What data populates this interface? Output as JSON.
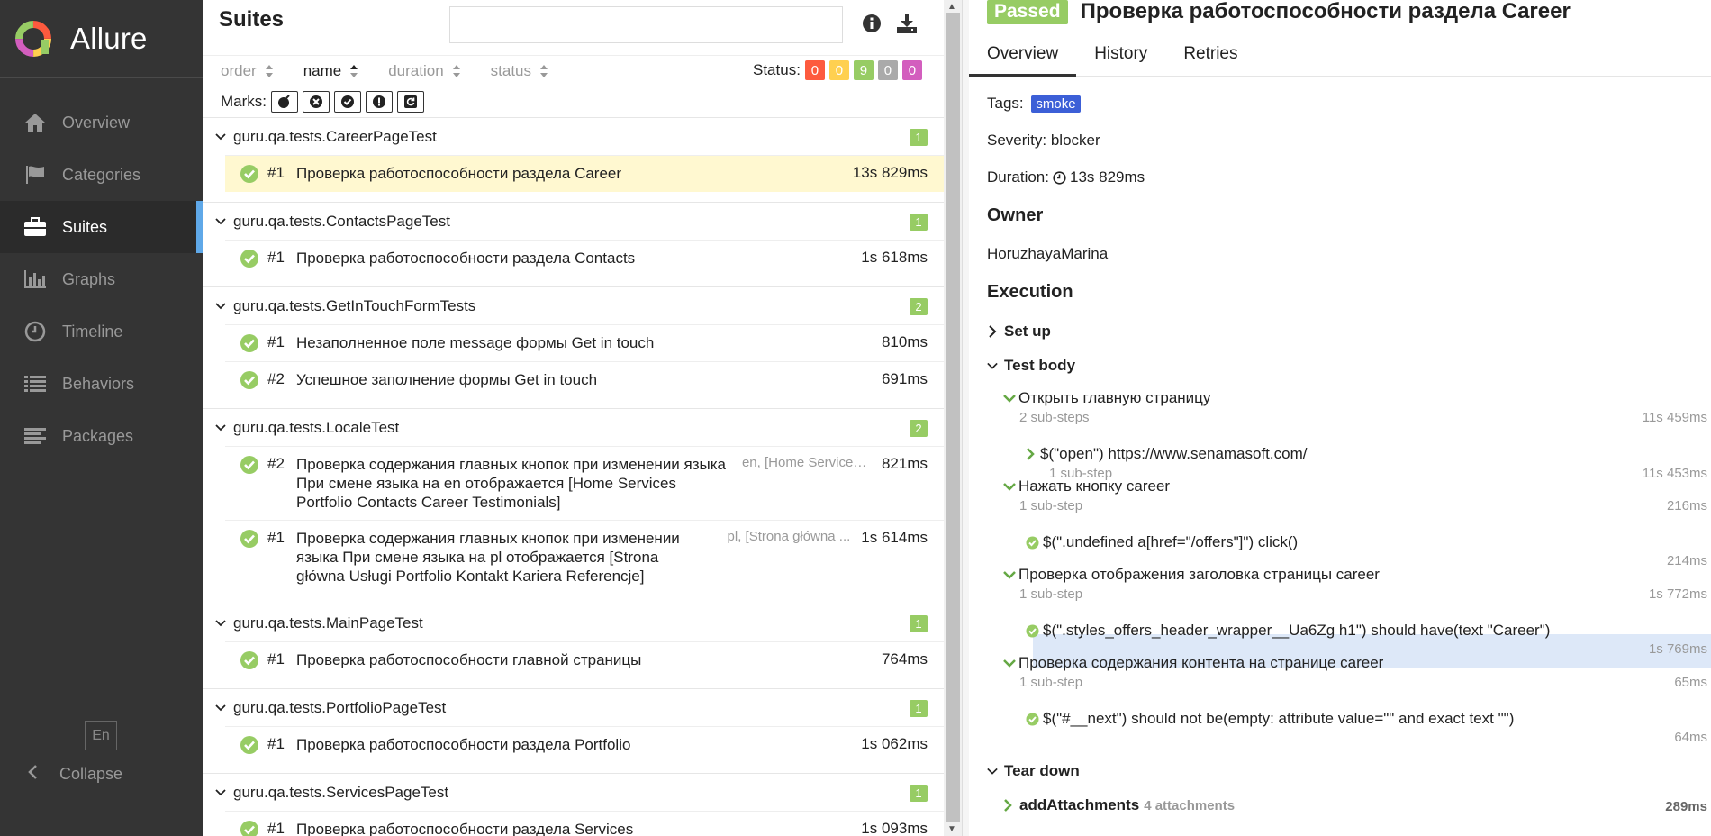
{
  "app": {
    "brand": "Allure",
    "lang": "En",
    "collapse": "Collapse"
  },
  "nav": [
    {
      "label": "Overview",
      "icon": "home-icon"
    },
    {
      "label": "Categories",
      "icon": "flag-icon"
    },
    {
      "label": "Suites",
      "icon": "briefcase-icon"
    },
    {
      "label": "Graphs",
      "icon": "bar-chart-icon"
    },
    {
      "label": "Timeline",
      "icon": "clock-icon"
    },
    {
      "label": "Behaviors",
      "icon": "list-icon"
    },
    {
      "label": "Packages",
      "icon": "align-left-icon"
    }
  ],
  "suites": {
    "title": "Suites",
    "search_placeholder": "",
    "sort": {
      "order": "order",
      "name": "name",
      "duration": "duration",
      "status": "status"
    },
    "status_label": "Status:",
    "status_counts": [
      {
        "value": "0",
        "color": "#fd5a3e"
      },
      {
        "value": "0",
        "color": "#ffd050"
      },
      {
        "value": "9",
        "color": "#97cc64"
      },
      {
        "value": "0",
        "color": "#aaaaaa"
      },
      {
        "value": "0",
        "color": "#d35ebe"
      }
    ],
    "marks_label": "Marks:",
    "groups": [
      {
        "name": "guru.qa.tests.CareerPageTest",
        "count": "1",
        "tests": [
          {
            "num": "#1",
            "name": "Проверка работоспособности раздела Career",
            "params": "",
            "dur": "13s 829ms",
            "selected": true
          }
        ]
      },
      {
        "name": "guru.qa.tests.ContactsPageTest",
        "count": "1",
        "tests": [
          {
            "num": "#1",
            "name": "Проверка работоспособности раздела Contacts",
            "params": "",
            "dur": "1s 618ms"
          }
        ]
      },
      {
        "name": "guru.qa.tests.GetInTouchFormTests",
        "count": "2",
        "tests": [
          {
            "num": "#1",
            "name": "Незаполненное поле message формы Get in touch",
            "params": "",
            "dur": "810ms"
          },
          {
            "num": "#2",
            "name": "Успешное заполнение формы Get in touch",
            "params": "",
            "dur": "691ms"
          }
        ]
      },
      {
        "name": "guru.qa.tests.LocaleTest",
        "count": "2",
        "tests": [
          {
            "num": "#2",
            "name": "Проверка содержания главных кнопок при изменении языка При смене языка на en отображается [Home Services Portfolio Contacts Career Testimonials]",
            "params": "en, [Home Services...",
            "dur": "821ms"
          },
          {
            "num": "#1",
            "name": "Проверка содержания главных кнопок при изменении языка При смене языка на pl отображается [Strona główna Usługi Portfolio Kontakt Kariera Referencje]",
            "params": "pl, [Strona główna ...",
            "dur": "1s 614ms"
          }
        ]
      },
      {
        "name": "guru.qa.tests.MainPageTest",
        "count": "1",
        "tests": [
          {
            "num": "#1",
            "name": "Проверка работоспособности главной страницы",
            "params": "",
            "dur": "764ms"
          }
        ]
      },
      {
        "name": "guru.qa.tests.PortfolioPageTest",
        "count": "1",
        "tests": [
          {
            "num": "#1",
            "name": "Проверка работоспособности раздела Portfolio",
            "params": "",
            "dur": "1s 062ms"
          }
        ]
      },
      {
        "name": "guru.qa.tests.ServicesPageTest",
        "count": "1",
        "tests": [
          {
            "num": "#1",
            "name": "Проверка работоспособности раздела Services",
            "params": "",
            "dur": "1s 093ms"
          }
        ]
      }
    ]
  },
  "detail": {
    "status": "Passed",
    "title": "Проверка работоспособности раздела Career",
    "tabs": [
      "Overview",
      "History",
      "Retries"
    ],
    "tags_label": "Tags:",
    "tag": "smoke",
    "severity": "Severity: blocker",
    "duration_label": "Duration:",
    "duration": "13s 829ms",
    "owner_title": "Owner",
    "owner": "HoruzhayaMarina",
    "execution_title": "Execution",
    "setup": "Set up",
    "test_body": "Test body",
    "teardown": "Tear down",
    "steps": [
      {
        "name": "Открыть главную страницу",
        "sub": "2 sub-steps",
        "time": "11s 459ms"
      },
      {
        "name": "$(\"open\") https://www.senamasoft.com/",
        "sub": "1 sub-step",
        "time": "11s 453ms"
      },
      {
        "name": "Нажать кнопку career",
        "sub": "1 sub-step",
        "time": "216ms"
      },
      {
        "name": "$(\".undefined a[href=\"/offers\"]\") click()",
        "sub": "",
        "time": "214ms"
      },
      {
        "name": "Проверка отображения заголовка страницы career",
        "sub": "1 sub-step",
        "time": "1s 772ms"
      },
      {
        "name": "$(\".styles_offers_header_wrapper__Ua6Zg h1\") should have(text \"Career\")",
        "sub": "",
        "time": "1s 769ms"
      },
      {
        "name": "Проверка содержания контента на странице career",
        "sub": "1 sub-step",
        "time": "65ms"
      },
      {
        "name": "$(\"#__next\") should not be(empty: attribute value=\"\" and exact text \"\")",
        "sub": "",
        "time": "64ms"
      }
    ],
    "attach": {
      "name": "addAttachments",
      "count": "4 attachments",
      "time": "289ms"
    }
  }
}
